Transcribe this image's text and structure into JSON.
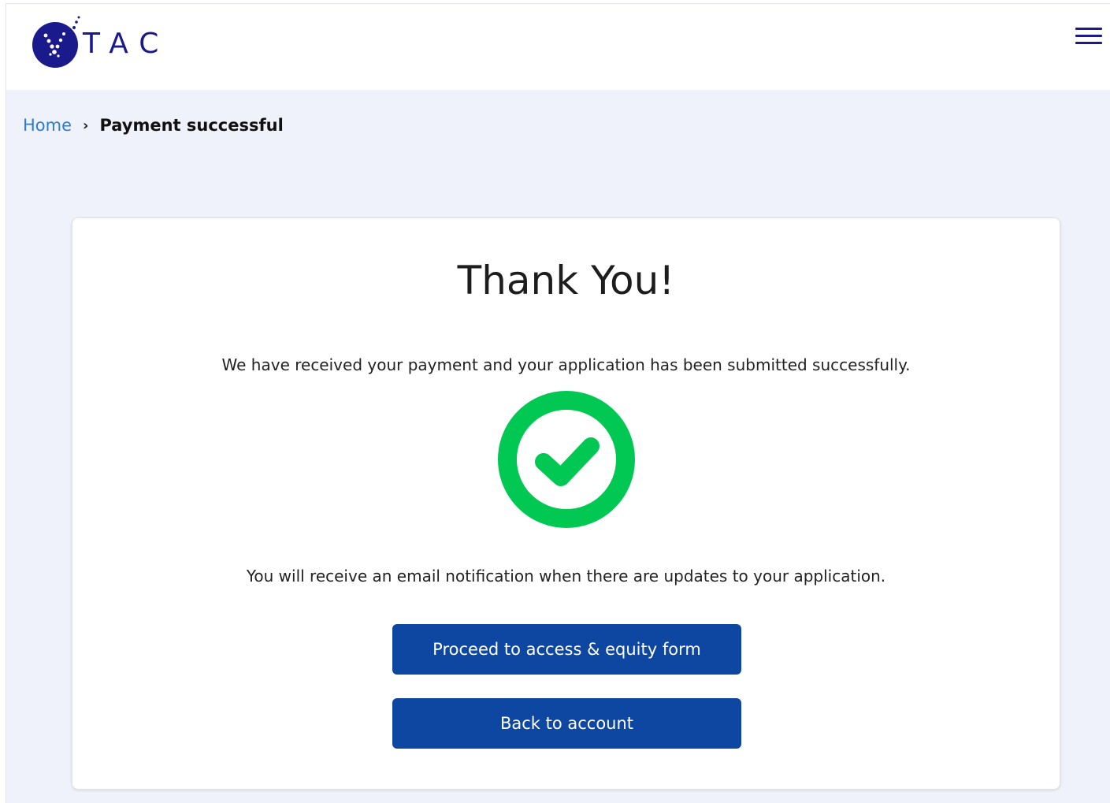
{
  "header": {
    "logo_text": "TAC",
    "logo_icon": "vtac-logo-icon",
    "menu_icon": "hamburger-menu-icon"
  },
  "breadcrumb": {
    "home": "Home",
    "separator": "›",
    "current": "Payment successful"
  },
  "card": {
    "title": "Thank You!",
    "message_received": "We have received your payment and your application has been submitted successfully.",
    "success_icon": "check-circle-icon",
    "message_notification": "You will receive an email notification when there are updates to your application.",
    "proceed_button": "Proceed to access & equity form",
    "back_button": "Back to account"
  },
  "colors": {
    "brand": "#1a1a8c",
    "link": "#2a7dd6",
    "button": "#0d47a1",
    "success": "#00c853",
    "page_bg": "#eff2fa"
  }
}
